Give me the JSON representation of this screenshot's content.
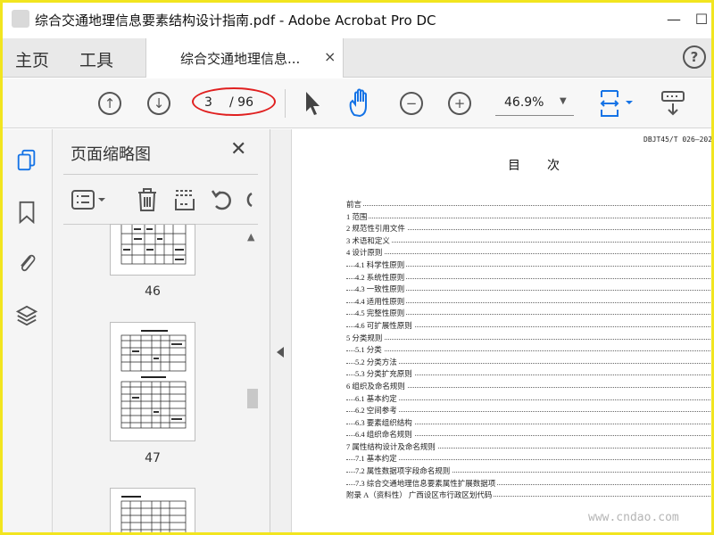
{
  "window": {
    "title": "综合交通地理信息要素结构设计指南.pdf - Adobe Acrobat Pro DC",
    "minimize_glyph": "—",
    "maximize_glyph": "☐"
  },
  "tabs": {
    "home": "主页",
    "tools": "工具",
    "document_tab": "综合交通地理信息...",
    "close_glyph": "×",
    "help_glyph": "?"
  },
  "toolbar": {
    "current_page": "3",
    "total_pages": "/ 96",
    "zoom": "46.9%"
  },
  "thumbnail_panel": {
    "title": "页面缩略图",
    "close_glyph": "✕",
    "pages": [
      {
        "label": "46"
      },
      {
        "label": "47"
      }
    ]
  },
  "document": {
    "code": "DBJT45/T 026—202",
    "heading": "目次",
    "toc": [
      {
        "text": "前言",
        "sub": false
      },
      {
        "text": "1  范围",
        "sub": false
      },
      {
        "text": "2  规范性引用文件",
        "sub": false
      },
      {
        "text": "3  术语和定义",
        "sub": false
      },
      {
        "text": "4  设计原则",
        "sub": false
      },
      {
        "text": "4.1  科学性原则",
        "sub": true
      },
      {
        "text": "4.2  系统性原则",
        "sub": true
      },
      {
        "text": "4.3  一致性原则",
        "sub": true
      },
      {
        "text": "4.4  适用性原则",
        "sub": true
      },
      {
        "text": "4.5  完整性原则",
        "sub": true
      },
      {
        "text": "4.6  可扩展性原则",
        "sub": true
      },
      {
        "text": "5  分类规则",
        "sub": false
      },
      {
        "text": "5.1  分类",
        "sub": true
      },
      {
        "text": "5.2  分类方法",
        "sub": true
      },
      {
        "text": "5.3  分类扩充原则",
        "sub": true
      },
      {
        "text": "6  组织及命名规则",
        "sub": false
      },
      {
        "text": "6.1  基本约定",
        "sub": true
      },
      {
        "text": "6.2  空间参考",
        "sub": true
      },
      {
        "text": "6.3  要素组织结构",
        "sub": true
      },
      {
        "text": "6.4  组织命名规则",
        "sub": true
      },
      {
        "text": "7  属性结构设计及命名规则",
        "sub": false
      },
      {
        "text": "7.1  基本约定",
        "sub": true
      },
      {
        "text": "7.2  属性数据项字段命名规则",
        "sub": true
      },
      {
        "text": "7.3  综合交通地理信息要素属性扩展数据项",
        "sub": true
      },
      {
        "text": "附录 A（资料性）  广西设区市行政区划代码",
        "sub": false
      }
    ],
    "watermark": "www.cndao.com"
  },
  "colors": {
    "accent_blue": "#1473e6",
    "annotation_red": "#e02020",
    "frame_yellow": "#f2e51f"
  }
}
